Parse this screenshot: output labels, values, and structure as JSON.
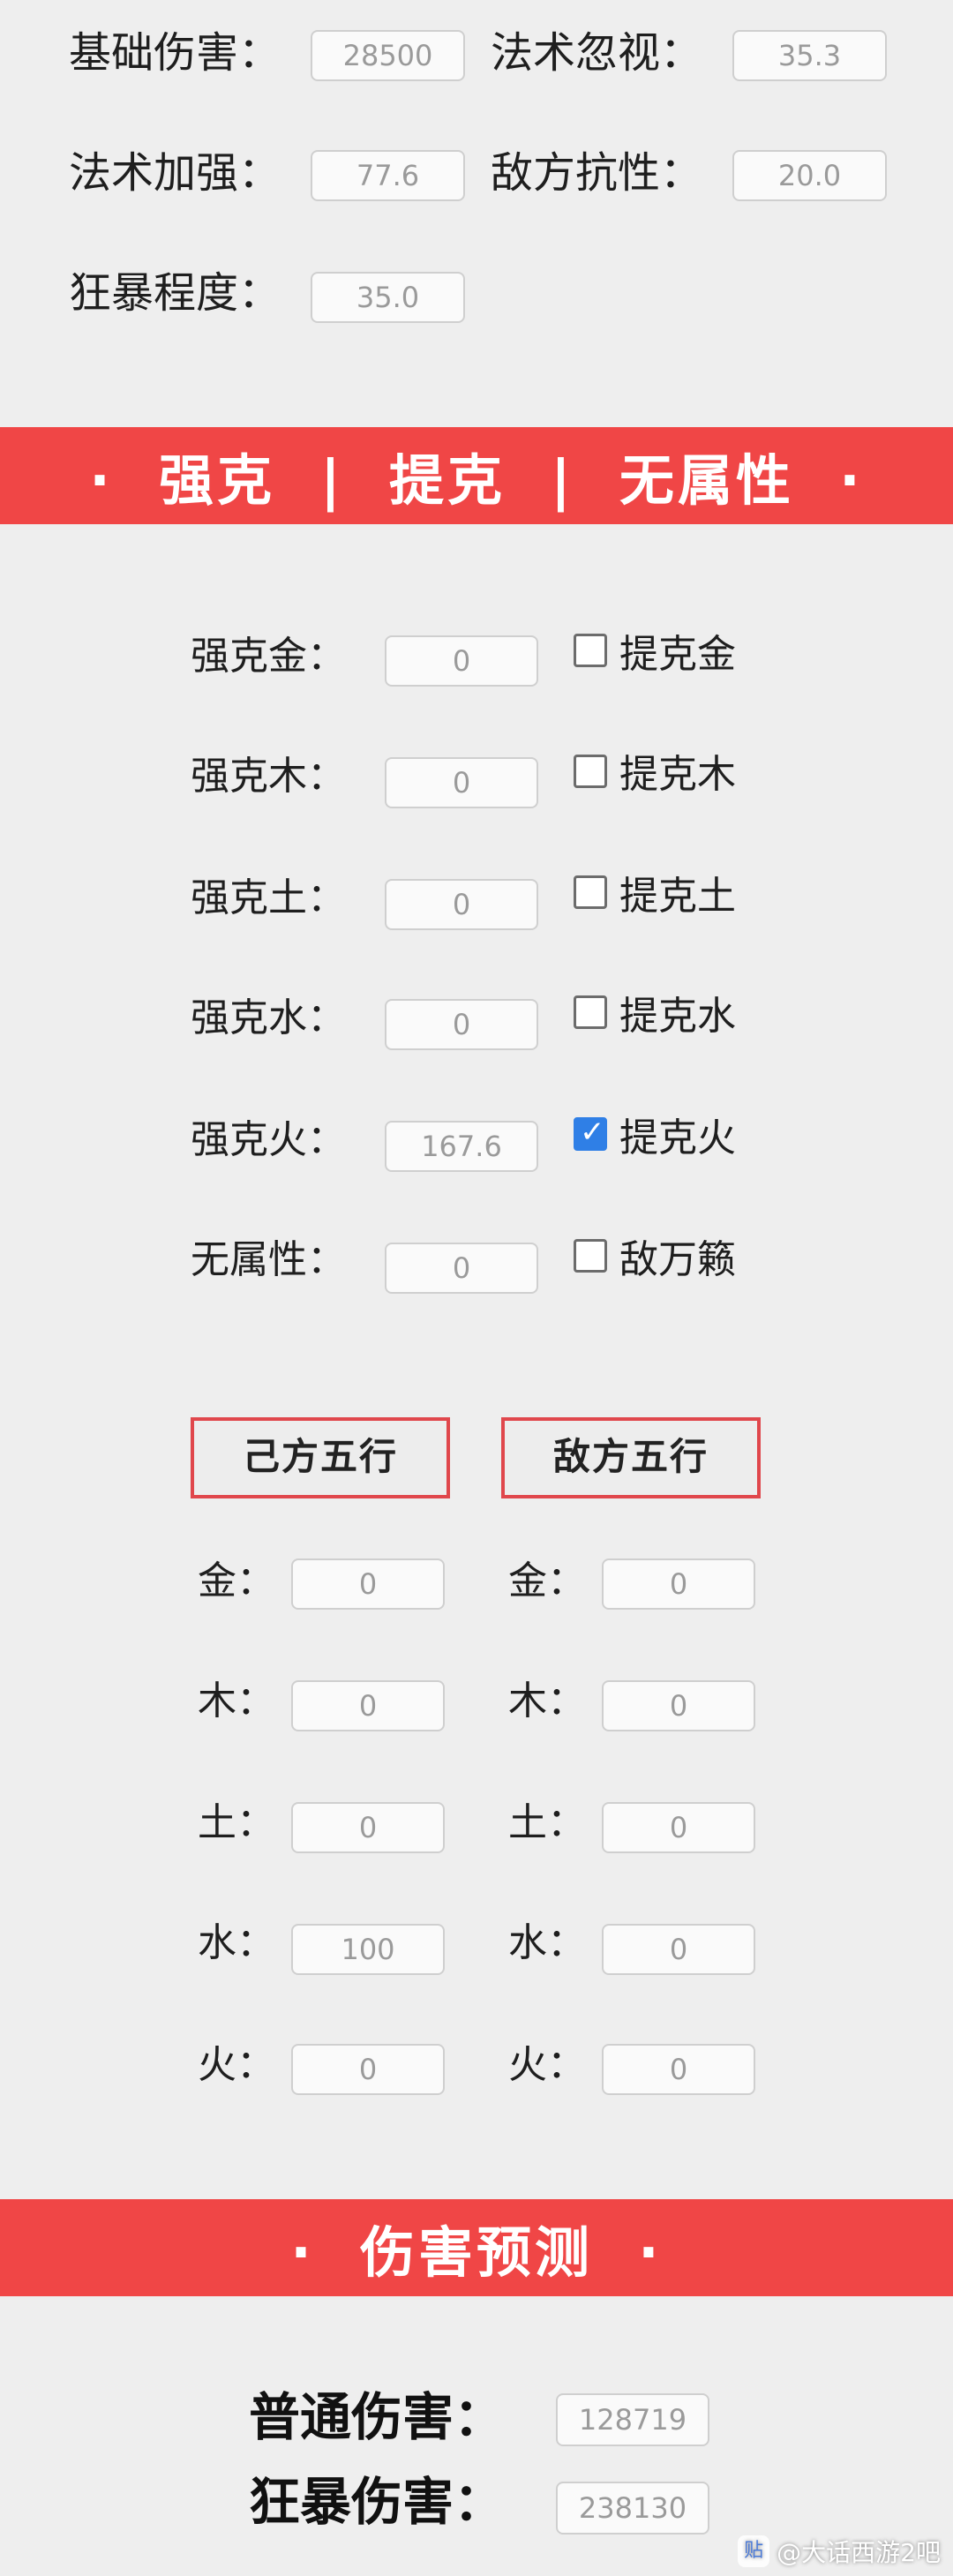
{
  "params": {
    "base_damage": {
      "label": "基础伤害：",
      "value": "28500"
    },
    "magic_ignore": {
      "label": "法术忽视：",
      "value": "35.3"
    },
    "magic_boost": {
      "label": "法术加强：",
      "value": "77.6"
    },
    "enemy_resist": {
      "label": "敌方抗性：",
      "value": "20.0"
    },
    "crit_level": {
      "label": "狂暴程度：",
      "value": "35.0"
    }
  },
  "banner1": "·  强克  |  提克  |  无属性  ·",
  "elements_rows": [
    {
      "label": "强克金：",
      "value": "0",
      "check_label": "提克金",
      "checked": false
    },
    {
      "label": "强克木：",
      "value": "0",
      "check_label": "提克木",
      "checked": false
    },
    {
      "label": "强克土：",
      "value": "0",
      "check_label": "提克土",
      "checked": false
    },
    {
      "label": "强克水：",
      "value": "0",
      "check_label": "提克水",
      "checked": false
    },
    {
      "label": "强克火：",
      "value": "167.6",
      "check_label": "提克火",
      "checked": true
    },
    {
      "label": "无属性：",
      "value": "0",
      "check_label": "敌万籁",
      "checked": false
    }
  ],
  "wuxing": {
    "self_header": "己方五行",
    "enemy_header": "敌方五行",
    "self": [
      {
        "label": "金：",
        "value": "0"
      },
      {
        "label": "木：",
        "value": "0"
      },
      {
        "label": "土：",
        "value": "0"
      },
      {
        "label": "水：",
        "value": "100"
      },
      {
        "label": "火：",
        "value": "0"
      }
    ],
    "enemy": [
      {
        "label": "金：",
        "value": "0"
      },
      {
        "label": "木：",
        "value": "0"
      },
      {
        "label": "土：",
        "value": "0"
      },
      {
        "label": "水：",
        "value": "0"
      },
      {
        "label": "火：",
        "value": "0"
      }
    ]
  },
  "banner2": "·  伤害预测  ·",
  "result": {
    "normal": {
      "label": "普通伤害：",
      "value": "128719"
    },
    "crit": {
      "label": "狂暴伤害：",
      "value": "238130"
    }
  },
  "watermark": {
    "icon": "tieba-icon",
    "text": "@大话西游2吧"
  },
  "colors": {
    "banner": "#f04646",
    "accent_border": "#e0474c",
    "checkbox_on": "#2f7fe6"
  }
}
